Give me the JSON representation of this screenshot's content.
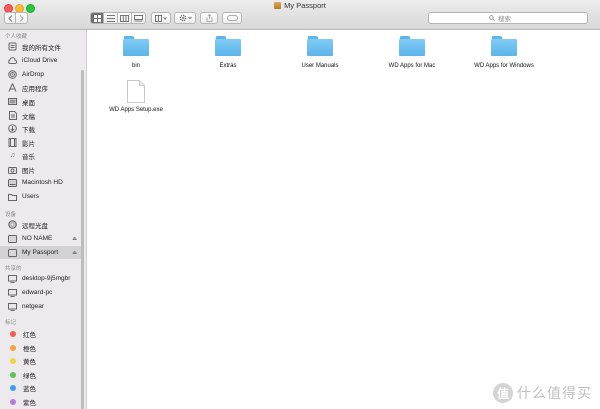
{
  "window": {
    "title": "My Passport"
  },
  "toolbar": {
    "back_icon": "chevron-left",
    "forward_icon": "chevron-right",
    "views": [
      "icon-view",
      "list-view",
      "column-view",
      "cover-flow-view"
    ],
    "group_icon": "group-by-icon",
    "action_icon": "gear-icon",
    "share_icon": "share-icon",
    "tag_icon": "tag-icon",
    "search": {
      "placeholder": "搜索"
    }
  },
  "sidebar": {
    "sections": [
      {
        "header": "个人收藏",
        "items": [
          {
            "label": "我的所有文件",
            "icon": "all-files-icon"
          },
          {
            "label": "iCloud Drive",
            "icon": "cloud-icon"
          },
          {
            "label": "AirDrop",
            "icon": "airdrop-icon"
          },
          {
            "label": "应用程序",
            "icon": "applications-icon"
          },
          {
            "label": "桌面",
            "icon": "desktop-icon"
          },
          {
            "label": "文稿",
            "icon": "documents-icon"
          },
          {
            "label": "下载",
            "icon": "download-icon"
          },
          {
            "label": "影片",
            "icon": "movies-icon"
          },
          {
            "label": "音乐",
            "icon": "music-icon"
          },
          {
            "label": "图片",
            "icon": "pictures-icon"
          },
          {
            "label": "Macintosh HD",
            "icon": "hard-drive-icon"
          },
          {
            "label": "Users",
            "icon": "folder-icon"
          }
        ]
      },
      {
        "header": "设备",
        "items": [
          {
            "label": "远程光盘",
            "icon": "remote-disc-icon"
          },
          {
            "label": "NO NAME",
            "icon": "drive-icon",
            "eject": true
          },
          {
            "label": "My Passport",
            "icon": "drive-icon",
            "eject": true,
            "selected": true
          }
        ]
      },
      {
        "header": "共享的",
        "items": [
          {
            "label": "desktop-9j5mgbr",
            "icon": "network-computer-icon"
          },
          {
            "label": "edward-pc",
            "icon": "network-computer-icon"
          },
          {
            "label": "netgear",
            "icon": "network-computer-icon"
          }
        ]
      },
      {
        "header": "标记",
        "items": [
          {
            "label": "红色",
            "color": "#f25a54"
          },
          {
            "label": "橙色",
            "color": "#f5a33a"
          },
          {
            "label": "黄色",
            "color": "#f3d33f"
          },
          {
            "label": "绿色",
            "color": "#5dc454"
          },
          {
            "label": "蓝色",
            "color": "#3f9ef3"
          },
          {
            "label": "紫色",
            "color": "#b77bdc"
          }
        ]
      }
    ]
  },
  "files": [
    {
      "name": "bin",
      "type": "folder"
    },
    {
      "name": "Extras",
      "type": "folder"
    },
    {
      "name": "User Manuals",
      "type": "folder"
    },
    {
      "name": "WD Apps for Mac",
      "type": "folder"
    },
    {
      "name": "WD Apps for Windows",
      "type": "folder"
    },
    {
      "name": "WD Apps Setup.exe",
      "type": "document"
    }
  ],
  "watermark": {
    "badge": "值",
    "text": "什么值得买"
  }
}
